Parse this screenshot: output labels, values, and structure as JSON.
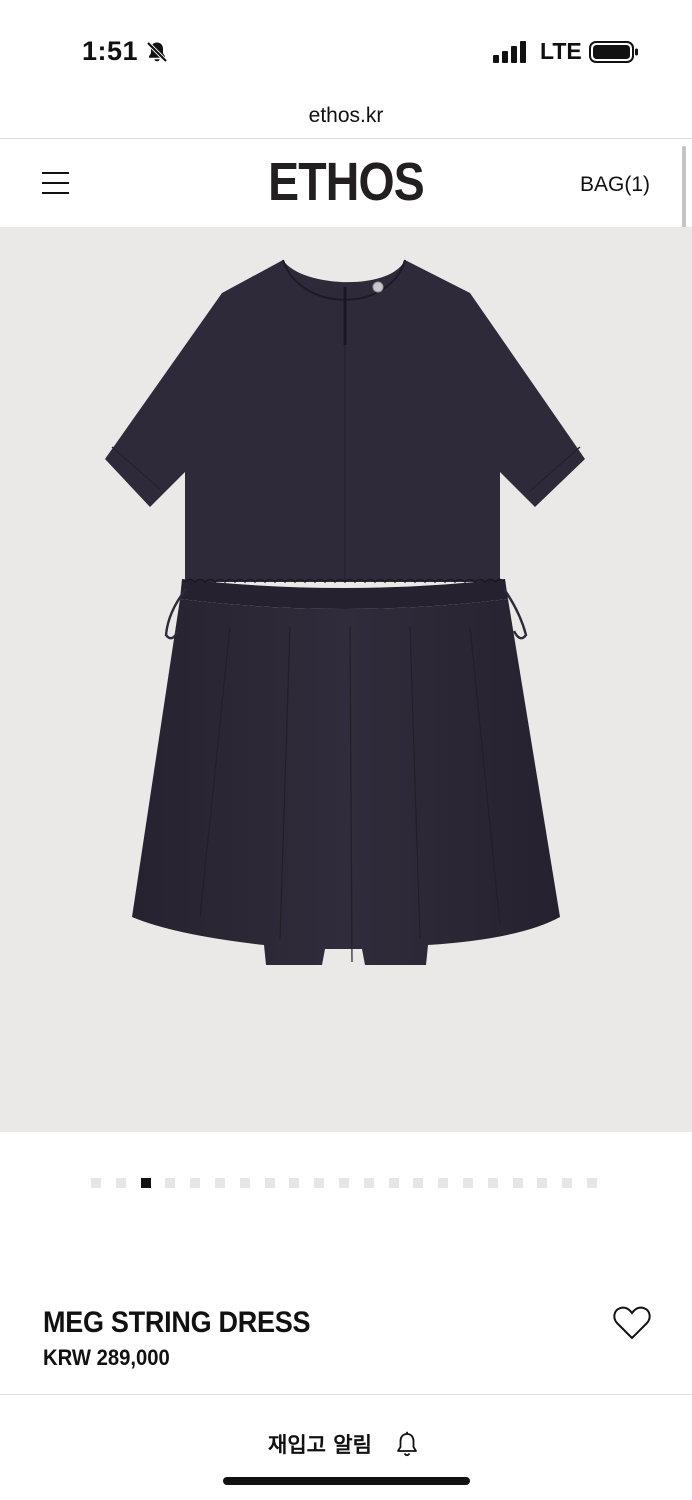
{
  "status_bar": {
    "time": "1:51",
    "network": "LTE"
  },
  "browser": {
    "url": "ethos.kr"
  },
  "header": {
    "logo": "ETHOS",
    "bag": "BAG(1)"
  },
  "product": {
    "image_alt": "MEG STRING DRESS",
    "name": "MEG STRING DRESS",
    "price": "KRW 289,000",
    "dress_color": "#2e2a39",
    "image_bg": "#ebe9e7"
  },
  "carousel": {
    "total": 21,
    "active_index": 2
  },
  "restock": {
    "label": "재입고 알림"
  }
}
